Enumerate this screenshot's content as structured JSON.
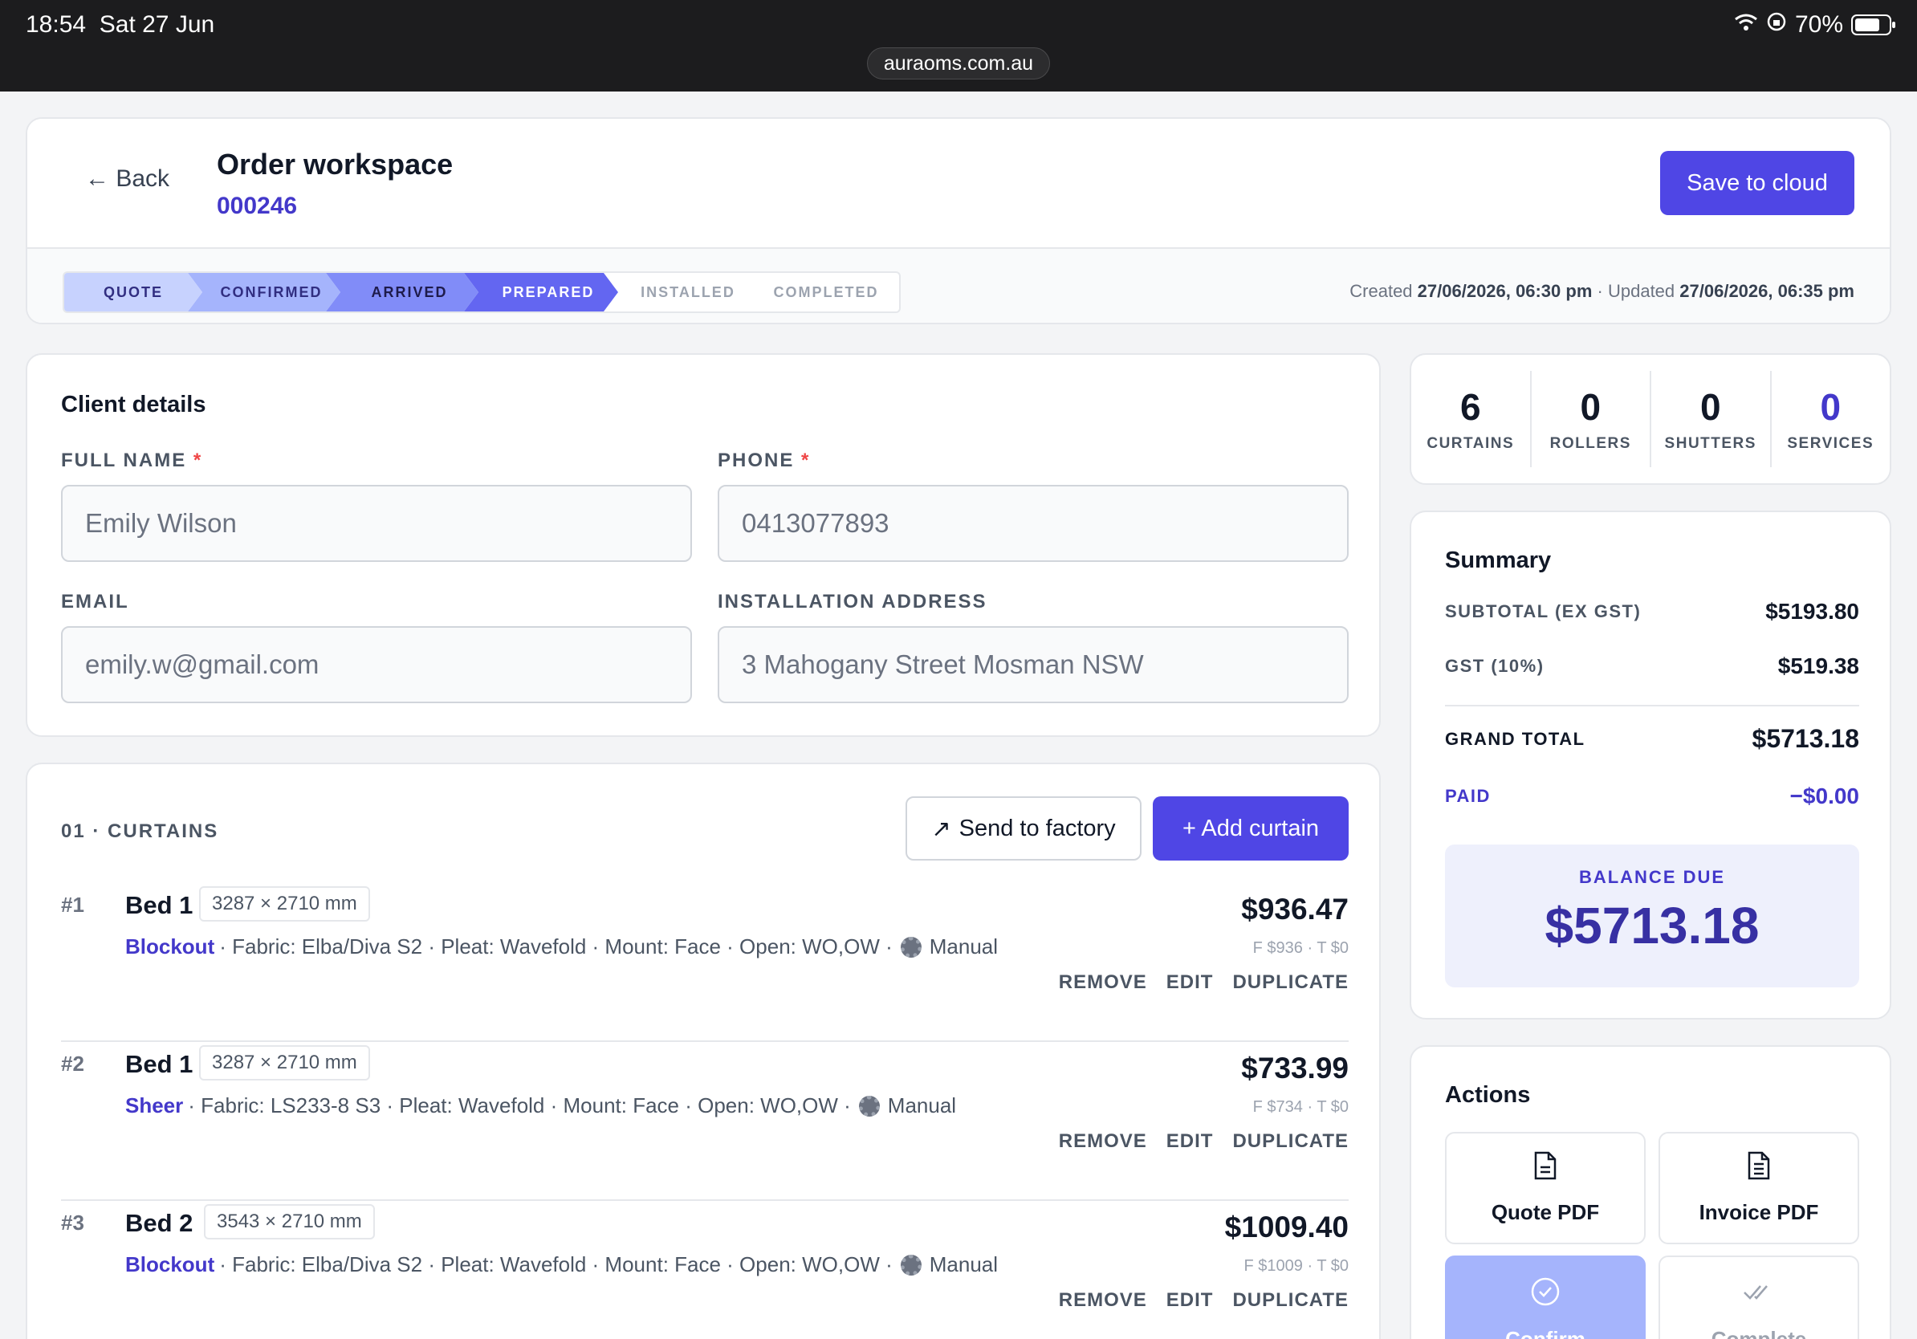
{
  "status_bar": {
    "time": "18:54",
    "date": "Sat 27 Jun",
    "battery": "70%",
    "url": "auraoms.com.au"
  },
  "header": {
    "back_label": "← Back",
    "title": "Order workspace",
    "order_number": "000246",
    "save_label": "Save to cloud",
    "created_label": "Created",
    "created_value": "27/06/2026, 06:30 pm",
    "separator": "·",
    "updated_label": "Updated",
    "updated_value": "27/06/2026, 06:35 pm",
    "steps": [
      {
        "label": "QUOTE",
        "state": "done"
      },
      {
        "label": "CONFIRMED",
        "state": "done"
      },
      {
        "label": "ARRIVED",
        "state": "done"
      },
      {
        "label": "PREPARED",
        "state": "current"
      },
      {
        "label": "INSTALLED",
        "state": "pending"
      },
      {
        "label": "COMPLETED",
        "state": "pending"
      }
    ]
  },
  "client": {
    "title": "Client details",
    "full_name_label": "FULL NAME",
    "full_name": "Emily Wilson",
    "phone_label": "PHONE",
    "phone": "0413077893",
    "required_mark": "*",
    "email_label": "EMAIL",
    "email": "emily.w@gmail.com",
    "address_label": "INSTALLATION ADDRESS",
    "address": "3 Mahogany Street Mosman NSW"
  },
  "curtains": {
    "section_label": "01 · CURTAINS",
    "send_label": "Send to factory",
    "add_label": "+ Add curtain",
    "items": [
      {
        "num": "#1",
        "name": "Bed 1",
        "dims": "3287 × 2710 mm",
        "type": "Blockout",
        "details": "· Fabric: Elba/Diva S2 · Pleat: Wavefold · Mount: Face · Open: WO,OW ·",
        "control": "Manual",
        "price": "$936.47",
        "sub": "F $936 · T $0"
      },
      {
        "num": "#2",
        "name": "Bed 1",
        "dims": "3287 × 2710 mm",
        "type": "Sheer",
        "details": "· Fabric: LS233-8 S3 · Pleat: Wavefold · Mount: Face · Open: WO,OW ·",
        "control": "Manual",
        "price": "$733.99",
        "sub": "F $734 · T $0"
      },
      {
        "num": "#3",
        "name": "Bed 2",
        "dims": "3543 × 2710 mm",
        "type": "Blockout",
        "details": "· Fabric: Elba/Diva S2 · Pleat: Wavefold · Mount: Face · Open: WO,OW ·",
        "control": "Manual",
        "price": "$1009.40",
        "sub": "F $1009 · T $0"
      }
    ],
    "remove_label": "REMOVE",
    "edit_label": "EDIT",
    "duplicate_label": "DUPLICATE"
  },
  "counts": [
    {
      "value": "6",
      "label": "CURTAINS"
    },
    {
      "value": "0",
      "label": "ROLLERS"
    },
    {
      "value": "0",
      "label": "SHUTTERS"
    },
    {
      "value": "0",
      "label": "SERVICES"
    }
  ],
  "summary": {
    "title": "Summary",
    "subtotal_label": "SUBTOTAL (EX GST)",
    "subtotal": "$5193.80",
    "gst_label": "GST (10%)",
    "gst": "$519.38",
    "grand_total_label": "GRAND TOTAL",
    "grand_total": "$5713.18",
    "paid_label": "PAID",
    "paid": "−$0.00",
    "balance_label": "BALANCE DUE",
    "balance": "$5713.18"
  },
  "actions": {
    "title": "Actions",
    "quote_pdf": "Quote PDF",
    "invoice_pdf": "Invoice PDF",
    "confirm": "Confirm",
    "complete": "Complete"
  },
  "colors": {
    "accent": "#4f46e5",
    "accent_dark": "#4338ca",
    "step_done": "#c7d2fe",
    "step_current": "#6366f1"
  }
}
